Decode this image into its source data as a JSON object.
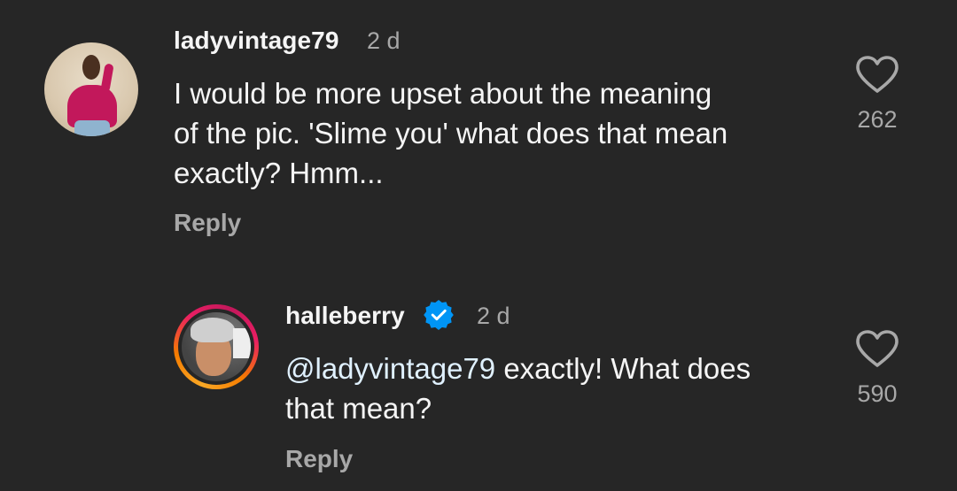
{
  "comments": [
    {
      "username": "ladyvintage79",
      "time": "2 d",
      "lines": [
        "I would be more upset about the meaning",
        "of the pic. 'Slime you' what does that mean",
        "exactly? Hmm..."
      ],
      "reply_label": "Reply",
      "likes": "262",
      "avatar_icon": "user-avatar-photo"
    },
    {
      "username": "halleberry",
      "verified": true,
      "time": "2 d",
      "mention": "@ladyvintage79",
      "text_after_mention": " exactly! What does",
      "line2": "that mean?",
      "reply_label": "Reply",
      "likes": "590",
      "avatar_icon": "story-ring-avatar-photo"
    }
  ],
  "colors": {
    "background": "#262626",
    "primary_text": "#f5f5f5",
    "secondary_text": "#a8a8a8",
    "verified_blue": "#0095f6",
    "mention": "#e0f1ff"
  },
  "icons": {
    "like": "heart-outline-icon",
    "verified": "verified-badge-icon"
  }
}
